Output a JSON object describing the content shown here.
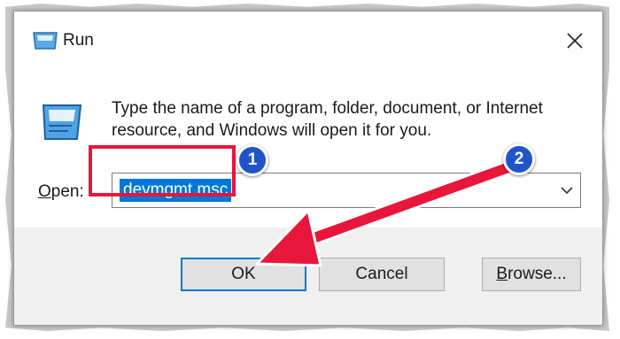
{
  "window": {
    "title": "Run",
    "icon": "run-icon",
    "close_icon": "close-icon"
  },
  "content": {
    "description": "Type the name of a program, folder, document, or Internet resource, and Windows will open it for you.",
    "open_label_accel": "O",
    "open_label_rest": "pen:",
    "open_value": "devmgmt.msc",
    "dropdown_icon": "chevron-down-icon"
  },
  "buttons": {
    "ok": "OK",
    "cancel": "Cancel",
    "browse_accel": "B",
    "browse_rest": "rowse..."
  },
  "annotations": {
    "badge_1": "1",
    "badge_2": "2",
    "highlight_color": "#e8163b",
    "arrow_color": "#e8163b",
    "badge_color": "#1f55c8"
  },
  "colors": {
    "selection": "#0078d7",
    "footer_bg": "#f0f0f0",
    "button_bg": "#e1e1e1"
  }
}
